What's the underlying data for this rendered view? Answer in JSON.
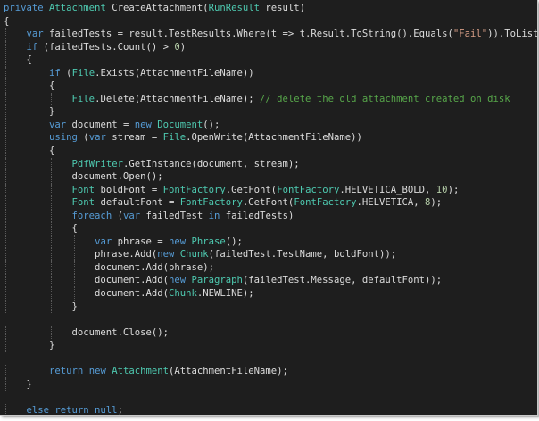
{
  "colors": {
    "background": "#1e1e1e",
    "text": "#dcdcdc",
    "keyword": "#569cd6",
    "type": "#4ec9b0",
    "string": "#d69d85",
    "number": "#b5cea8",
    "comment": "#57a64a"
  },
  "code_lines": [
    [
      [
        "kw",
        "private "
      ],
      [
        "ty",
        "Attachment"
      ],
      [
        "id",
        " CreateAttachment("
      ],
      [
        "ty",
        "RunResult"
      ],
      [
        "id",
        " result)"
      ]
    ],
    [
      [
        "id",
        "{"
      ]
    ],
    [
      [
        "id",
        "    "
      ],
      [
        "kw",
        "var"
      ],
      [
        "id",
        " failedTests = result.TestResults.Where(t => t.Result.ToString().Equals("
      ],
      [
        "str",
        "\"Fail\""
      ],
      [
        "id",
        ")).ToList();"
      ]
    ],
    [
      [
        "id",
        "    "
      ],
      [
        "kw",
        "if"
      ],
      [
        "id",
        " (failedTests.Count() > "
      ],
      [
        "num",
        "0"
      ],
      [
        "id",
        ")"
      ]
    ],
    [
      [
        "id",
        "    {"
      ]
    ],
    [
      [
        "id",
        "        "
      ],
      [
        "kw",
        "if"
      ],
      [
        "id",
        " ("
      ],
      [
        "ty",
        "File"
      ],
      [
        "id",
        ".Exists(AttachmentFileName))"
      ]
    ],
    [
      [
        "id",
        "        {"
      ]
    ],
    [
      [
        "id",
        "            "
      ],
      [
        "ty",
        "File"
      ],
      [
        "id",
        ".Delete(AttachmentFileName); "
      ],
      [
        "cm",
        "// delete the old attachment created on disk"
      ]
    ],
    [
      [
        "id",
        "        }"
      ]
    ],
    [
      [
        "id",
        "        "
      ],
      [
        "kw",
        "var"
      ],
      [
        "id",
        " document = "
      ],
      [
        "kw",
        "new "
      ],
      [
        "ty",
        "Document"
      ],
      [
        "id",
        "();"
      ]
    ],
    [
      [
        "id",
        "        "
      ],
      [
        "kw",
        "using"
      ],
      [
        "id",
        " ("
      ],
      [
        "kw",
        "var"
      ],
      [
        "id",
        " stream = "
      ],
      [
        "ty",
        "File"
      ],
      [
        "id",
        ".OpenWrite(AttachmentFileName))"
      ]
    ],
    [
      [
        "id",
        "        {"
      ]
    ],
    [
      [
        "id",
        "            "
      ],
      [
        "ty",
        "PdfWriter"
      ],
      [
        "id",
        ".GetInstance(document, stream);"
      ]
    ],
    [
      [
        "id",
        "            document.Open();"
      ]
    ],
    [
      [
        "id",
        "            "
      ],
      [
        "ty",
        "Font"
      ],
      [
        "id",
        " boldFont = "
      ],
      [
        "ty",
        "FontFactory"
      ],
      [
        "id",
        ".GetFont("
      ],
      [
        "ty",
        "FontFactory"
      ],
      [
        "id",
        ".HELVETICA_BOLD, "
      ],
      [
        "num",
        "10"
      ],
      [
        "id",
        ");"
      ]
    ],
    [
      [
        "id",
        "            "
      ],
      [
        "ty",
        "Font"
      ],
      [
        "id",
        " defaultFont = "
      ],
      [
        "ty",
        "FontFactory"
      ],
      [
        "id",
        ".GetFont("
      ],
      [
        "ty",
        "FontFactory"
      ],
      [
        "id",
        ".HELVETICA, "
      ],
      [
        "num",
        "8"
      ],
      [
        "id",
        ");"
      ]
    ],
    [
      [
        "id",
        "            "
      ],
      [
        "kw",
        "foreach"
      ],
      [
        "id",
        " ("
      ],
      [
        "kw",
        "var"
      ],
      [
        "id",
        " failedTest "
      ],
      [
        "kw",
        "in"
      ],
      [
        "id",
        " failedTests)"
      ]
    ],
    [
      [
        "id",
        "            {"
      ]
    ],
    [
      [
        "id",
        "                "
      ],
      [
        "kw",
        "var"
      ],
      [
        "id",
        " phrase = "
      ],
      [
        "kw",
        "new "
      ],
      [
        "ty",
        "Phrase"
      ],
      [
        "id",
        "();"
      ]
    ],
    [
      [
        "id",
        "                phrase.Add("
      ],
      [
        "kw",
        "new "
      ],
      [
        "ty",
        "Chunk"
      ],
      [
        "id",
        "(failedTest.TestName, boldFont));"
      ]
    ],
    [
      [
        "id",
        "                document.Add(phrase);"
      ]
    ],
    [
      [
        "id",
        "                document.Add("
      ],
      [
        "kw",
        "new "
      ],
      [
        "ty",
        "Paragraph"
      ],
      [
        "id",
        "(failedTest.Message, defaultFont));"
      ]
    ],
    [
      [
        "id",
        "                document.Add("
      ],
      [
        "ty",
        "Chunk"
      ],
      [
        "id",
        ".NEWLINE);"
      ]
    ],
    [
      [
        "id",
        "            }"
      ]
    ],
    [
      [
        "id",
        ""
      ]
    ],
    [
      [
        "id",
        "            document.Close();"
      ]
    ],
    [
      [
        "id",
        "        }"
      ]
    ],
    [
      [
        "id",
        ""
      ]
    ],
    [
      [
        "id",
        "        "
      ],
      [
        "kw",
        "return "
      ],
      [
        "kw",
        "new "
      ],
      [
        "ty",
        "Attachment"
      ],
      [
        "id",
        "(AttachmentFileName);"
      ]
    ],
    [
      [
        "id",
        "    }"
      ]
    ],
    [
      [
        "id",
        ""
      ]
    ],
    [
      [
        "id",
        "    "
      ],
      [
        "kw",
        "else return null"
      ],
      [
        "id",
        ";"
      ]
    ],
    [
      [
        "id",
        "}"
      ]
    ]
  ]
}
